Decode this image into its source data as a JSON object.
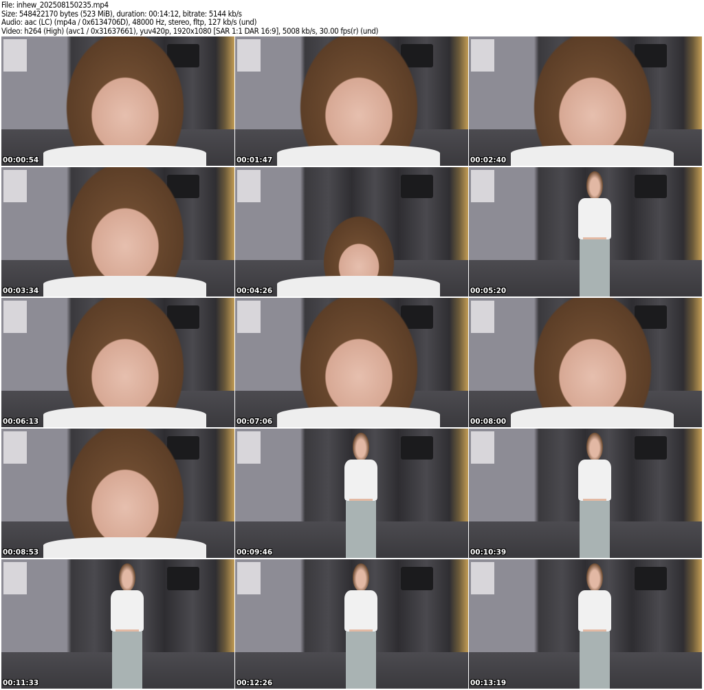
{
  "header": {
    "file": "File: inhew_202508150235.mp4",
    "size": "Size: 548422170 bytes (523 MiB), duration: 00:14:12, bitrate: 5144 kb/s",
    "audio": "Audio: aac (LC) (mp4a / 0x6134706D), 48000 Hz, stereo, fltp, 127 kb/s (und)",
    "video": "Video: h264 (High) (avc1 / 0x31637661), yuv420p, 1920x1080 [SAR 1:1 DAR 16:9], 5008 kb/s, 30.00 fps(r) (und)"
  },
  "thumbnails": [
    {
      "timestamp": "00:00:54"
    },
    {
      "timestamp": "00:01:47"
    },
    {
      "timestamp": "00:02:40"
    },
    {
      "timestamp": "00:03:34"
    },
    {
      "timestamp": "00:04:26"
    },
    {
      "timestamp": "00:05:20"
    },
    {
      "timestamp": "00:06:13"
    },
    {
      "timestamp": "00:07:06"
    },
    {
      "timestamp": "00:08:00"
    },
    {
      "timestamp": "00:08:53"
    },
    {
      "timestamp": "00:09:46"
    },
    {
      "timestamp": "00:10:39"
    },
    {
      "timestamp": "00:11:33"
    },
    {
      "timestamp": "00:12:26"
    },
    {
      "timestamp": "00:13:19"
    }
  ]
}
